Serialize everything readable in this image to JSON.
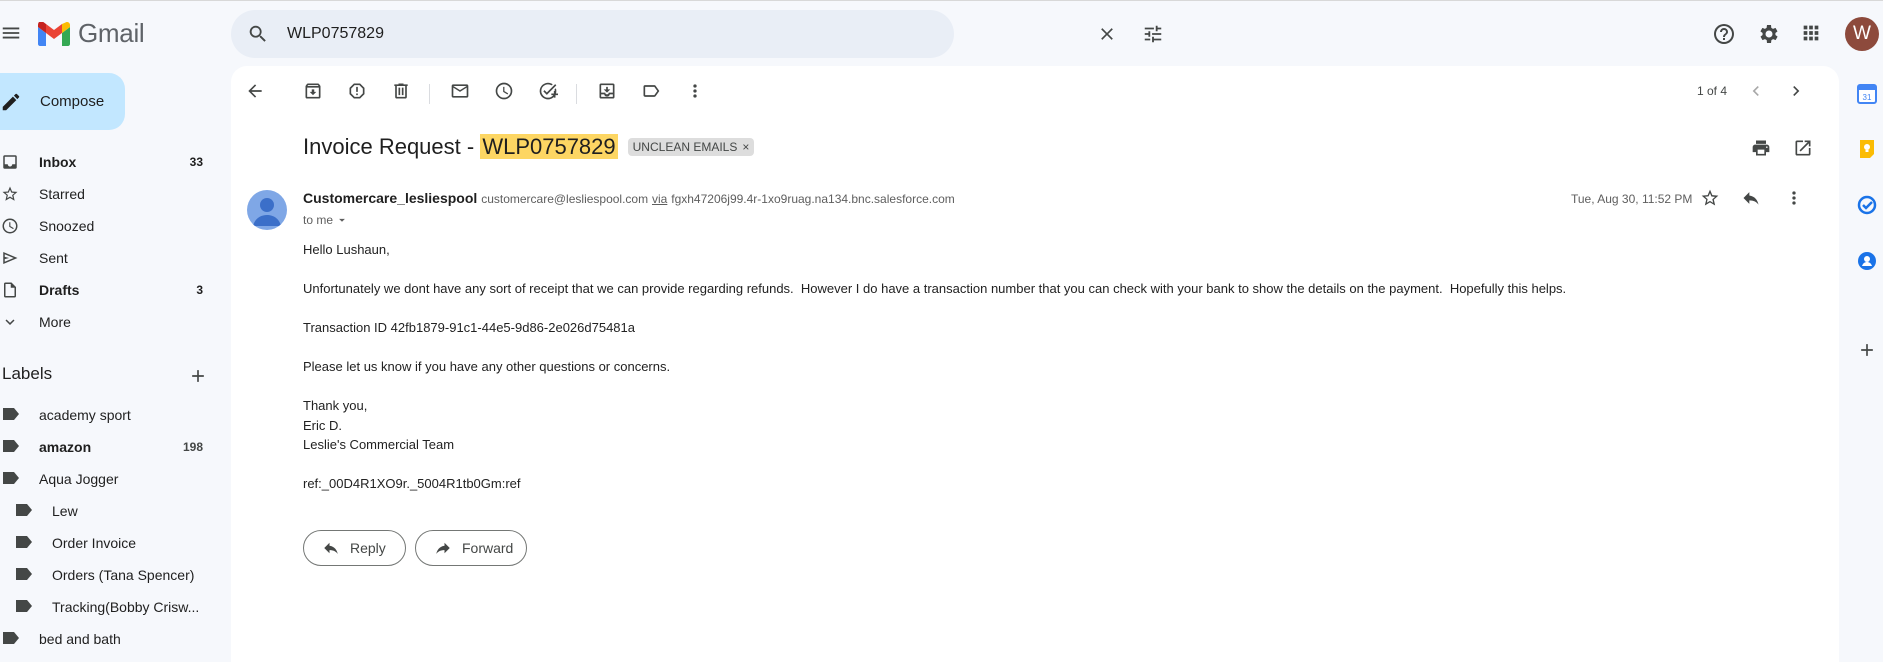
{
  "app": {
    "name": "Gmail"
  },
  "search": {
    "value": "WLP0757829"
  },
  "sidebar": {
    "compose_label": "Compose",
    "nav": [
      {
        "label": "Inbox",
        "count": "33",
        "icon": "inbox-icon",
        "bold": true
      },
      {
        "label": "Starred",
        "count": "",
        "icon": "star-icon",
        "bold": false
      },
      {
        "label": "Snoozed",
        "count": "",
        "icon": "clock-icon",
        "bold": false
      },
      {
        "label": "Sent",
        "count": "",
        "icon": "send-icon",
        "bold": false
      },
      {
        "label": "Drafts",
        "count": "3",
        "icon": "draft-icon",
        "bold": true
      },
      {
        "label": "More",
        "count": "",
        "icon": "chevron-down-icon",
        "bold": false
      }
    ],
    "labels_title": "Labels",
    "labels": [
      {
        "label": "academy sport",
        "count": "",
        "bold": false,
        "indent": 0
      },
      {
        "label": "amazon",
        "count": "198",
        "bold": true,
        "indent": 0
      },
      {
        "label": "Aqua Jogger",
        "count": "",
        "bold": false,
        "indent": 0
      },
      {
        "label": "Lew",
        "count": "",
        "bold": false,
        "indent": 1
      },
      {
        "label": "Order Invoice",
        "count": "",
        "bold": false,
        "indent": 1
      },
      {
        "label": "Orders (Tana Spencer)",
        "count": "",
        "bold": false,
        "indent": 1
      },
      {
        "label": "Tracking(Bobby Crisw...",
        "count": "",
        "bold": false,
        "indent": 1
      },
      {
        "label": "bed and bath",
        "count": "",
        "bold": false,
        "indent": 0
      }
    ]
  },
  "toolbar": {
    "pager": "1 of 4"
  },
  "email": {
    "subject_prefix": "Invoice Request - ",
    "subject_highlight": "WLP0757829",
    "label_chip": "UNCLEAN EMAILS",
    "chip_close": "×",
    "sender_name": "Customercare_lesliespool",
    "sender_email": "customercare@lesliespool.com",
    "via": "via",
    "via_domain": "fgxh47206j99.4r-1xo9ruag.na134.bnc.salesforce.com",
    "to": "to me",
    "date": "Tue, Aug 30, 11:52 PM",
    "body": [
      "Hello Lushaun,",
      "Unfortunately we dont have any sort of receipt that we can provide regarding refunds.  However I do have a transaction number that you can check with your bank to show the details on the payment.  Hopefully this helps.",
      "Transaction ID 42fb1879-91c1-44e5-9d86-2e026d75481a",
      "Please let us know if you have any other questions or concerns.",
      "Thank you,",
      "Eric D.",
      "Leslie's Commercial Team",
      "ref:_00D4R1XO9r._5004R1tb0Gm:ref"
    ],
    "reply_label": "Reply",
    "forward_label": "Forward"
  },
  "user": {
    "initial": "W"
  },
  "rail": {
    "calendar_day": "31"
  },
  "colors": {
    "accent": "#0b57d0",
    "compose_bg": "#c2e7ff",
    "search_highlight": "#fdd663",
    "avatar": "#8d4a3c"
  }
}
